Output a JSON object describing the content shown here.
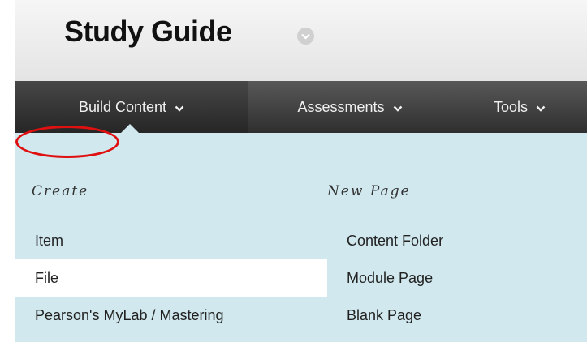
{
  "header": {
    "title": "Study Guide",
    "title_menu_icon": "chevron-down-circle-icon"
  },
  "nav": {
    "tabs": [
      {
        "label": "Build Content",
        "icon": "chevron-down-icon",
        "active": true
      },
      {
        "label": "Assessments",
        "icon": "chevron-down-icon",
        "active": false
      },
      {
        "label": "Tools",
        "icon": "chevron-down-icon",
        "active": false
      }
    ]
  },
  "menu": {
    "create": {
      "heading": "Create",
      "items": [
        "Item",
        "File",
        "Pearson's MyLab / Mastering"
      ]
    },
    "new_page": {
      "heading": "New Page",
      "items": [
        "Content Folder",
        "Module Page",
        "Blank Page"
      ]
    },
    "highlighted_item": "File"
  },
  "colors": {
    "navbar": "#3f3f3f",
    "dropdown_bg": "#d0e8ee",
    "highlight": "#ffffff",
    "annotation": "#e01010"
  }
}
